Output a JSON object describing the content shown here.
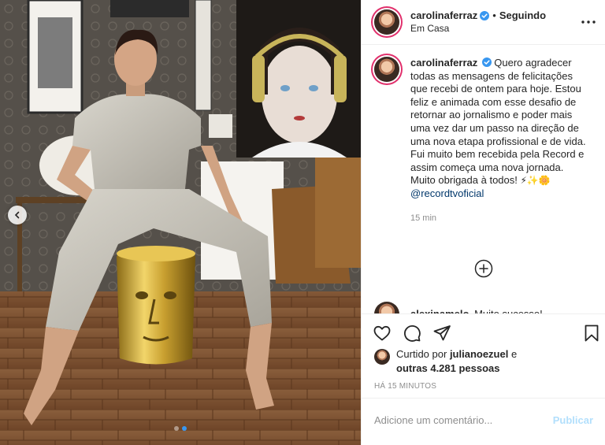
{
  "post": {
    "username": "carolinaferraz",
    "follow_status": "Seguindo",
    "separator": "•",
    "location": "Em Casa",
    "more_label": "•••"
  },
  "caption": {
    "username": "carolinaferraz",
    "text": "Quero agradecer todas as mensagens de felicitações que recebi de ontem para hoje. Estou feliz e animada com esse desafio de retornar ao jornalismo e poder mais uma vez dar um passo na direção de uma nova etapa profissional e de vida. Fui muito bem recebida pela Record e assim começa uma nova jornada.",
    "thanks": "Muito obrigada à todos!",
    "emojis": "⚡✨🌼",
    "mention": "@recordtvoficial",
    "time": "15 min"
  },
  "comment": {
    "username": "alexinamelo",
    "text": "Muito sucesso!"
  },
  "likes": {
    "prefix": "Curtido por",
    "user": "julianoezuel",
    "connector": "e",
    "others": "outras 4.281 pessoas"
  },
  "timestamp": "HÁ 15 MINUTOS",
  "add_comment": {
    "placeholder": "Adicione um comentário...",
    "publish_label": "Publicar"
  },
  "carousel": {
    "slide_count": 2,
    "active_slide": 1
  },
  "colors": {
    "verified": "#3897f0",
    "story_ring": "#e1306c",
    "link": "#00376b",
    "publish_disabled": "#b2dffc",
    "muted": "#8e8e8e"
  }
}
